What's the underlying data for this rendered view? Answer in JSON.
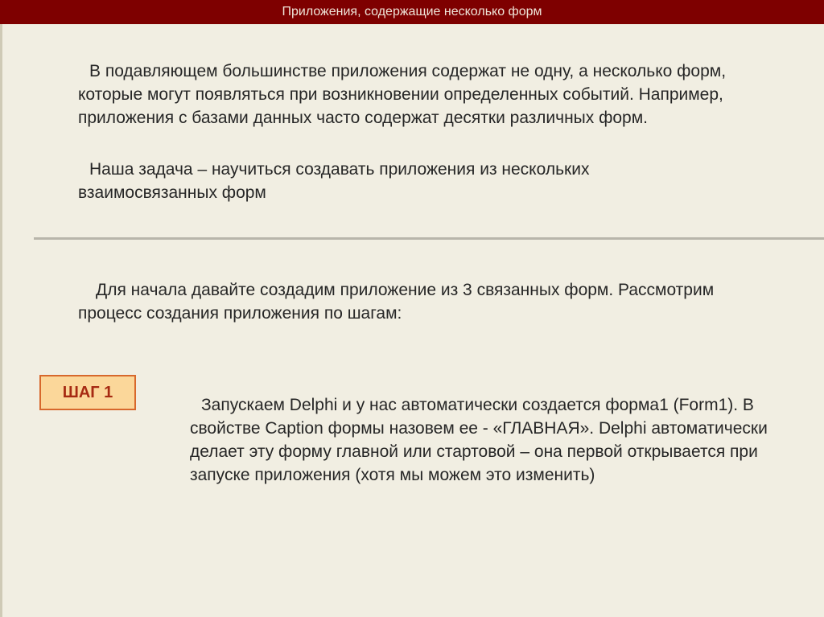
{
  "header": {
    "title": "Приложения, содержащие несколько форм"
  },
  "content": {
    "paragraph_1": "В подавляющем большинстве приложения содержат не одну, а несколько форм, которые могут появляться при возникновении определенных событий. Например, приложения с базами данных часто содержат десятки различных форм.",
    "paragraph_2": "Наша задача – научиться создавать приложения из нескольких взаимосвязанных форм",
    "paragraph_3": "Для начала давайте создадим приложение из 3 связанных форм. Рассмотрим процесс создания приложения по шагам:",
    "step_label": "ШАГ 1",
    "step_text": "Запускаем Delphi и у нас автоматически создается форма1 (Form1). В свойстве Caption формы назовем ее -  «ГЛАВНАЯ». Delphi автоматически делает эту форму главной или стартовой – она первой открывается при запуске приложения (хотя мы можем это изменить)"
  },
  "colors": {
    "header_background": "#7e0000",
    "page_background": "#f1eee2",
    "badge_fill": "#fbd79a",
    "badge_border": "#d7682c",
    "badge_text": "#a62a12"
  }
}
